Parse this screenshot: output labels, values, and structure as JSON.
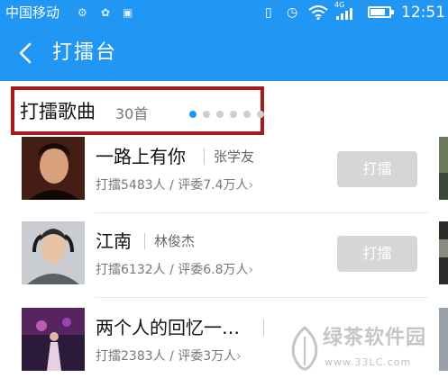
{
  "status_bar": {
    "carrier": "中国移动",
    "network": "4G",
    "time": "12:51",
    "battery_level": 0.8,
    "icons": [
      "settings-icon",
      "sync-icon",
      "image-icon",
      "vibrate-icon",
      "alarm-icon",
      "wifi-icon",
      "signal-icon",
      "battery-icon"
    ]
  },
  "header": {
    "title": "打擂台",
    "back_icon": "chevron-left-icon"
  },
  "section": {
    "title": "打擂歌曲",
    "count": "30首",
    "page_dots": 6,
    "active_dot": 0
  },
  "songs": [
    {
      "title": "一路上有你",
      "artist": "张学友",
      "stats": "打擂5483人 / 评委7.4万人",
      "button": "打擂"
    },
    {
      "title": "江南",
      "artist": "林俊杰",
      "stats": "打擂6132人 / 评委6.8万人",
      "button": "打擂"
    },
    {
      "title": "两个人的回忆一…",
      "artist": "",
      "stats": "打擂2383人 / 评委3万人",
      "button": ""
    }
  ],
  "watermark": {
    "text": "绿茶软件园",
    "url": "www.33LC.com"
  },
  "colors": {
    "primary": "#2196f3",
    "highlight_border": "#a61c1c",
    "button_disabled": "#d6d6d6"
  }
}
